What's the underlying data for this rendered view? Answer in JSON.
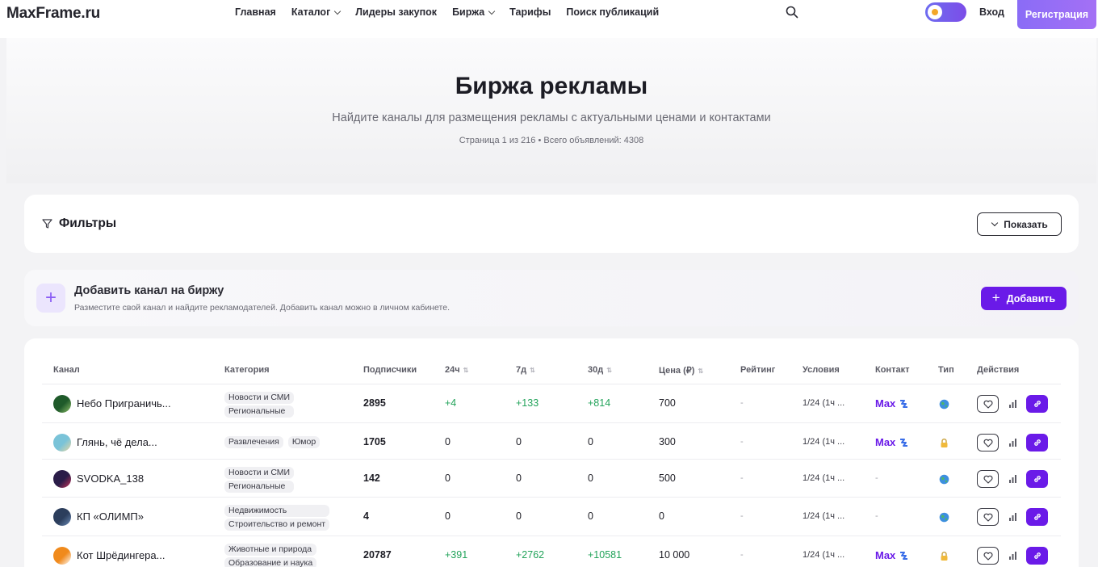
{
  "header": {
    "logo": "MaxFrame.ru",
    "nav": [
      {
        "label": "Главная",
        "dropdown": false
      },
      {
        "label": "Каталог",
        "dropdown": true
      },
      {
        "label": "Лидеры закупок",
        "dropdown": false
      },
      {
        "label": "Биржа",
        "dropdown": true
      },
      {
        "label": "Тарифы",
        "dropdown": false
      },
      {
        "label": "Поиск публикаций",
        "dropdown": false
      }
    ],
    "search_icon": "search-icon",
    "theme_toggle_icon": "theme-toggle",
    "login_label": "Вход",
    "register_label": "Регистрация"
  },
  "hero": {
    "title": "Биржа рекламы",
    "subtitle": "Найдите каналы для размещения рекламы с актуальными ценами и контактами",
    "meta": "Страница 1 из 216 • Всего объявлений: 4308"
  },
  "filters": {
    "title": "Фильтры",
    "icon": "filter-icon",
    "show_label": "Показать"
  },
  "add_channel": {
    "title": "Добавить канал на биржу",
    "subtitle": "Разместите свой канал и найдите рекламодателей. Добавить канал можно в личном кабинете.",
    "button_label": "Добавить"
  },
  "table": {
    "headers": {
      "channel": "Канал",
      "category": "Категория",
      "subscribers": "Подписчики",
      "d24": "24ч",
      "d7": "7д",
      "d30": "30д",
      "price": "Цена (₽)",
      "rating": "Рейтинг",
      "conditions": "Условия",
      "contact": "Контакт",
      "type": "Тип",
      "actions": "Действия"
    },
    "rows": [
      {
        "name": "Небо Приграничь...",
        "cats": [
          "Новости и СМИ",
          "Региональные"
        ],
        "subs": "2895",
        "d24": "+4",
        "d7": "+133",
        "d30": "+814",
        "price": "700",
        "rating": "-",
        "cond": "1/24 (1ч ...",
        "contact": "Max",
        "type": "globe"
      },
      {
        "name": "Глянь, чё дела...",
        "cats": [
          "Развлечения",
          "Юмор"
        ],
        "subs": "1705",
        "d24": "0",
        "d7": "0",
        "d30": "0",
        "price": "300",
        "rating": "-",
        "cond": "1/24 (1ч ...",
        "contact": "Max",
        "type": "lock"
      },
      {
        "name": "SVODKA_138",
        "cats": [
          "Новости и СМИ",
          "Региональные"
        ],
        "subs": "142",
        "d24": "0",
        "d7": "0",
        "d30": "0",
        "price": "500",
        "rating": "-",
        "cond": "1/24 (1ч ...",
        "contact": "-",
        "type": "globe"
      },
      {
        "name": "КП «ОЛИМП»",
        "cats": [
          "Недвижимость",
          "Строительство и ремонт"
        ],
        "subs": "4",
        "d24": "0",
        "d7": "0",
        "d30": "0",
        "price": "0",
        "rating": "-",
        "cond": "1/24 (1ч ...",
        "contact": "-",
        "type": "globe"
      },
      {
        "name": "Кот Шрёдингера...",
        "cats": [
          "Животные и природа",
          "Образование и наука"
        ],
        "subs": "20787",
        "d24": "+391",
        "d7": "+2762",
        "d30": "+10581",
        "price": "10 000",
        "rating": "-",
        "cond": "1/24 (1ч ...",
        "contact": "Max",
        "type": "lock"
      }
    ]
  },
  "colors": {
    "accent": "#6a1ae8",
    "positive": "#22a35a",
    "register_gradient_start": "#8a6cf6"
  }
}
